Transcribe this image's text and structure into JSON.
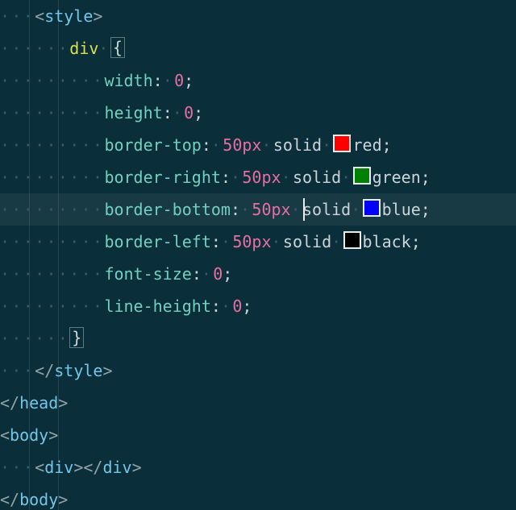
{
  "code": {
    "tags": {
      "style_open": "style",
      "style_close": "style",
      "head_close": "head",
      "body_open": "body",
      "body_close": "body",
      "div_open": "div",
      "div_close": "div"
    },
    "selector": "div",
    "brace_open": "{",
    "brace_close": "}",
    "decls": [
      {
        "prop": "width",
        "num": "0",
        "unit": "",
        "kw": "",
        "color": null
      },
      {
        "prop": "height",
        "num": "0",
        "unit": "",
        "kw": "",
        "color": null
      },
      {
        "prop": "border-top",
        "num": "50",
        "unit": "px",
        "kw": "solid",
        "color": "red",
        "swatch": "#ff0000"
      },
      {
        "prop": "border-right",
        "num": "50",
        "unit": "px",
        "kw": "solid",
        "color": "green",
        "swatch": "#008000"
      },
      {
        "prop": "border-bottom",
        "num": "50",
        "unit": "px",
        "kw": "solid",
        "color": "blue",
        "swatch": "#0000ff"
      },
      {
        "prop": "border-left",
        "num": "50",
        "unit": "px",
        "kw": "solid",
        "color": "black",
        "swatch": "#000000"
      },
      {
        "prop": "font-size",
        "num": "0",
        "unit": "",
        "kw": "",
        "color": null
      },
      {
        "prop": "line-height",
        "num": "0",
        "unit": "",
        "kw": "",
        "color": null
      }
    ],
    "ws_dot": "·"
  },
  "cursor": {
    "line_index": 6
  }
}
